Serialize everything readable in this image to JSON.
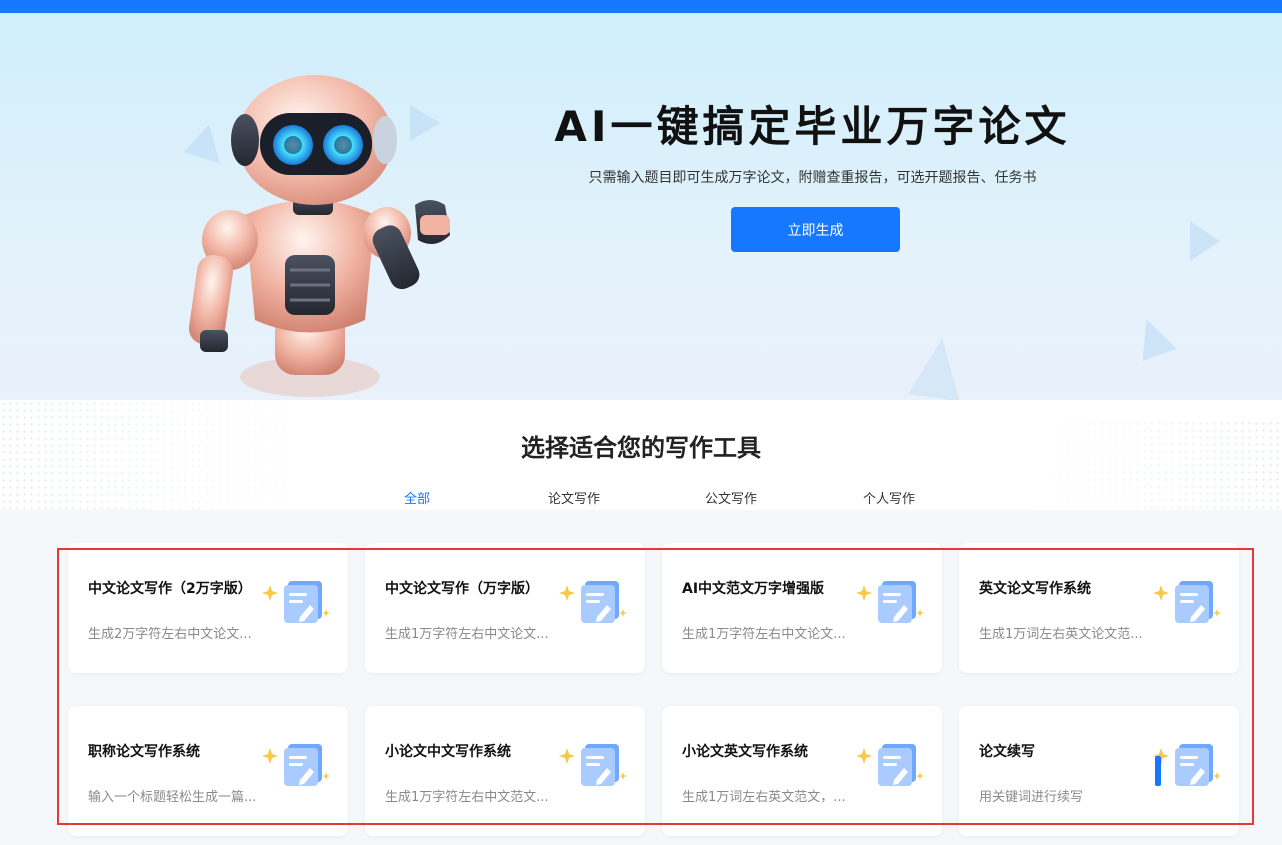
{
  "hero": {
    "title": "AI一键搞定毕业万字论文",
    "subtitle": "只需输入题目即可生成万字论文，附赠查重报告，可选开题报告、任务书",
    "cta_label": "立即生成"
  },
  "section": {
    "title": "选择适合您的写作工具",
    "tabs": [
      {
        "label": "全部",
        "active": true
      },
      {
        "label": "论文写作",
        "active": false
      },
      {
        "label": "公文写作",
        "active": false
      },
      {
        "label": "个人写作",
        "active": false
      }
    ]
  },
  "cards": [
    {
      "title": "中文论文写作（2万字版）",
      "desc": "生成2万字符左右中文论文..."
    },
    {
      "title": "中文论文写作（万字版）",
      "desc": "生成1万字符左右中文论文..."
    },
    {
      "title": "AI中文范文万字增强版",
      "desc": "生成1万字符左右中文论文..."
    },
    {
      "title": "英文论文写作系统",
      "desc": "生成1万词左右英文论文范..."
    },
    {
      "title": "职称论文写作系统",
      "desc": "输入一个标题轻松生成一篇..."
    },
    {
      "title": "小论文中文写作系统",
      "desc": "生成1万字符左右中文范文..."
    },
    {
      "title": "小论文英文写作系统",
      "desc": "生成1万词左右英文范文，..."
    },
    {
      "title": "论文续写",
      "desc": "用关键词进行续写"
    }
  ],
  "colors": {
    "primary": "#1677ff",
    "highlight": "#e53935",
    "sparkle": "#f7c948"
  },
  "icons": {
    "card_icon": "document-edit-icon",
    "sparkle": "sparkle-icon",
    "hero_art": "robot-illustration"
  }
}
